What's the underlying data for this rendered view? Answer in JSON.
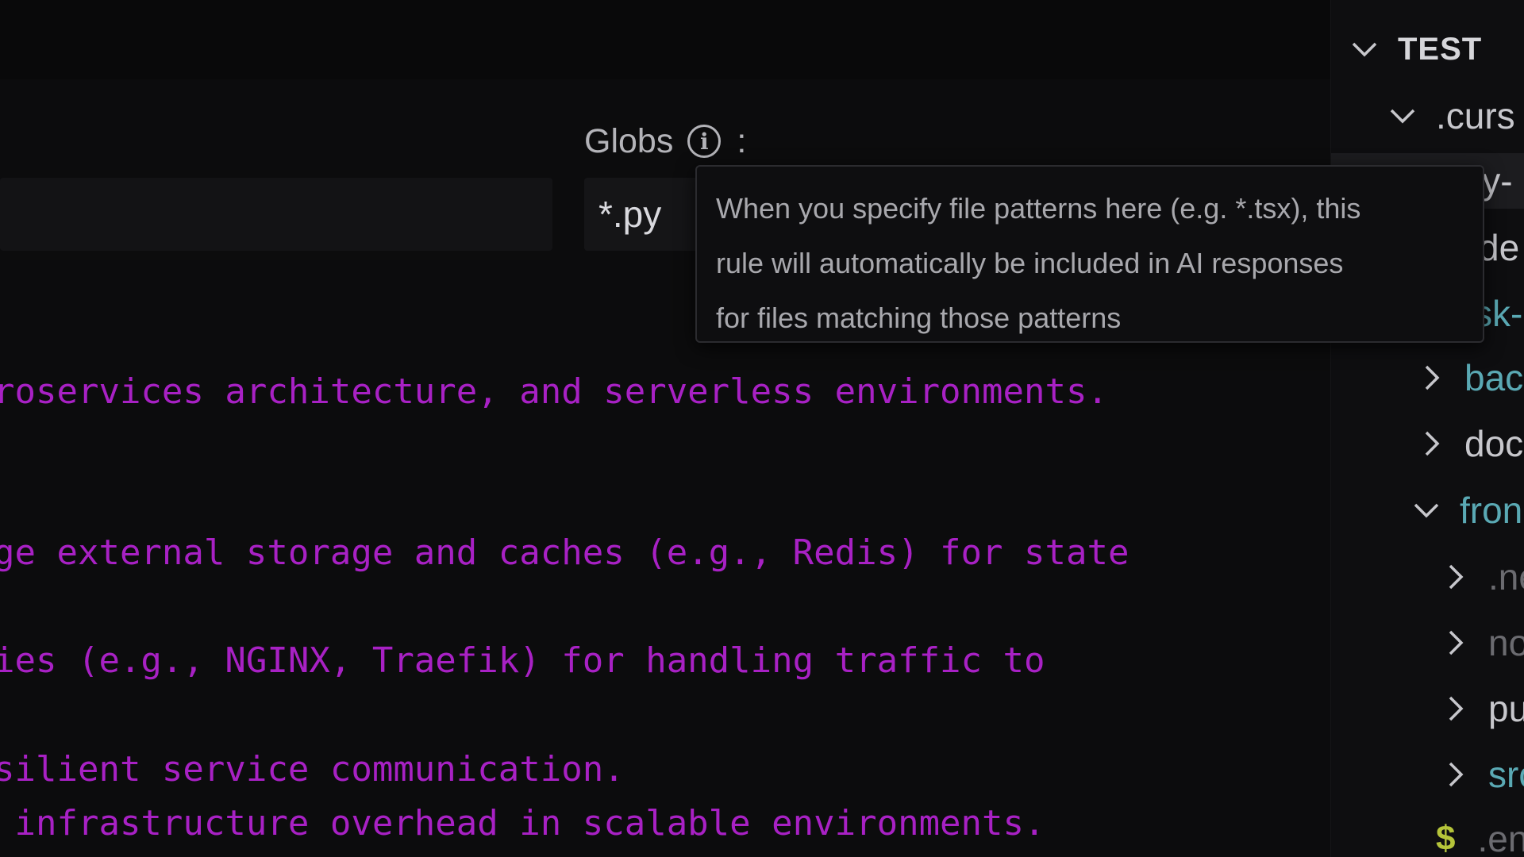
{
  "rule_form": {
    "globs_label": "Globs",
    "globs_colon": ":",
    "info_glyph": "i",
    "globs_value": "*.py"
  },
  "tooltip": {
    "lines": [
      "When you specify file patterns here (e.g. *.tsx), this",
      "rule will automatically be included in AI responses",
      "for files matching those patterns"
    ]
  },
  "code": {
    "lines": [
      "roservices architecture, and serverless environments.",
      "ge external storage and caches (e.g., Redis) for state",
      "ies (e.g., NGINX, Traefik) for handling traffic to",
      "silient service communication.",
      " infrastructure overhead in scalable environments."
    ]
  },
  "explorer": {
    "root": "TEST",
    "items": [
      {
        "label": ".curs",
        "kind": "folder-open"
      },
      {
        "label": "ly-",
        "kind": "file-selected"
      },
      {
        "label": "de",
        "kind": "file"
      },
      {
        "label": "sk-",
        "kind": "file"
      },
      {
        "label": "bac",
        "kind": "folder-closed"
      },
      {
        "label": "doc",
        "kind": "folder-closed"
      },
      {
        "label": "fron",
        "kind": "folder-open"
      },
      {
        "label": ".ne",
        "kind": "folder-closed"
      },
      {
        "label": "no",
        "kind": "folder-closed"
      },
      {
        "label": "pu",
        "kind": "folder-closed"
      },
      {
        "label": "src",
        "kind": "folder-closed"
      },
      {
        "label": ".en",
        "kind": "env-file",
        "icon_text": "$"
      }
    ]
  },
  "colors": {
    "code_text": "#a821c4",
    "teal_folder": "#5aa9b4",
    "env_icon": "#b5c43a"
  }
}
